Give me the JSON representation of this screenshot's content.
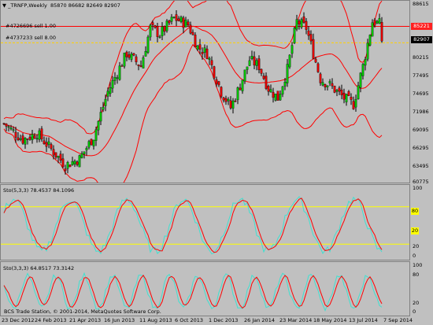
{
  "header": {
    "symbol": "_TRNFP,Weekly",
    "ohlc": "85870 86682 82649 82907"
  },
  "orders": [
    {
      "label": "#4726696 sell 1.00"
    },
    {
      "label": "#4737233 sell 8.00"
    }
  ],
  "price_axis": [
    "88615",
    "85221",
    "82907",
    "80215",
    "77495",
    "74695",
    "71986",
    "69095",
    "66295",
    "63495",
    "60775"
  ],
  "highlights": {
    "bid": "85221",
    "last": "82907"
  },
  "ind1": {
    "title": "Sto(5,3,3) 78.4537 84.1096",
    "levels": [
      "100",
      "80",
      "20",
      "0"
    ],
    "hi": "80",
    "lo": "20"
  },
  "ind2": {
    "title": "Sto(3,3,3) 64.8517 73.3142",
    "levels": [
      "100",
      "80",
      "20",
      "0"
    ]
  },
  "copyright": "BCS Trade Station, © 2001-2014, MetaQuotes Software Corp.",
  "xaxis": [
    "23 Dec 2012",
    "24 Feb 2013",
    "21 Apr 2013",
    "16 Jun 2013",
    "11 Aug 2013",
    "6 Oct 2013",
    "1 Dec 2013",
    "26 Jan 2014",
    "23 Mar 2014",
    "18 May 2014",
    "13 Jul 2014",
    "7 Sep 2014"
  ],
  "colors": {
    "bg": "#c0c0c0",
    "up": "#00c000",
    "down": "#e00000",
    "line": "#ff0000",
    "sig": "#40e0d0",
    "level": "#ffff00",
    "hl_bid": "#ff2020",
    "hl_last": "#000000"
  }
}
